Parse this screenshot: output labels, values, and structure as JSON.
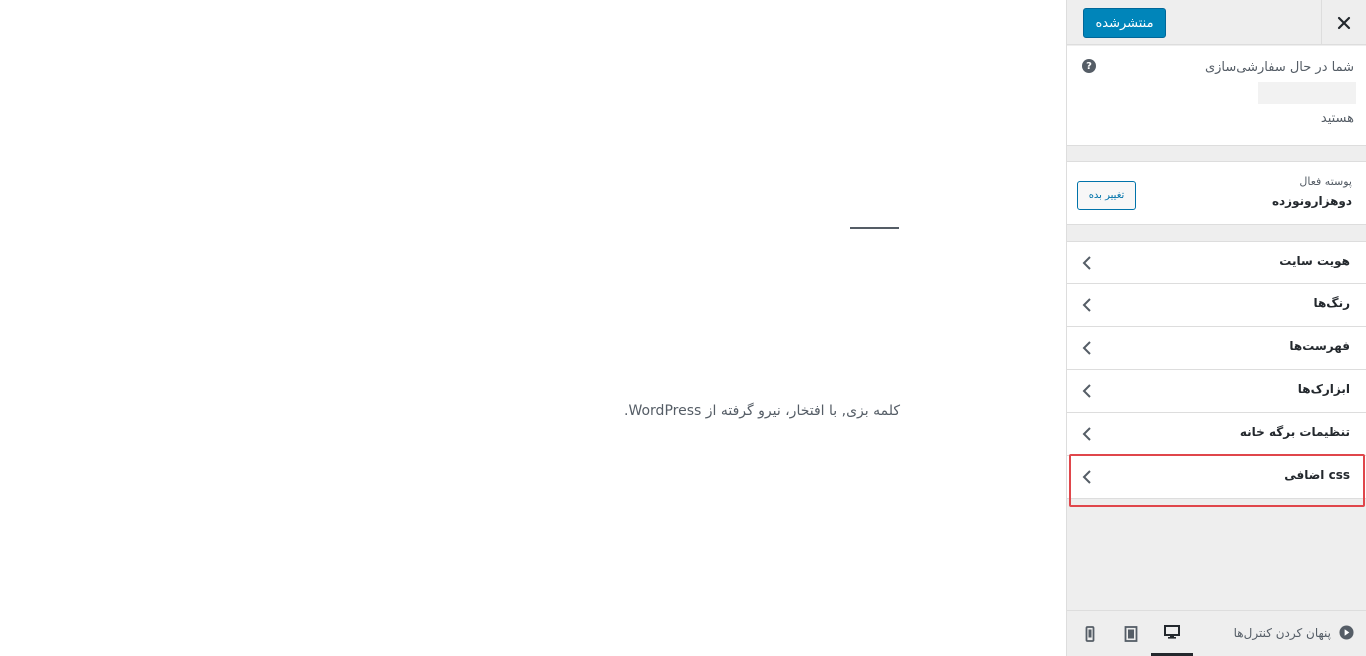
{
  "header": {
    "publish_label": "منتشرشده",
    "close_icon": "close-icon"
  },
  "info": {
    "line1": "شما در حال سفارشی‌سازی",
    "line3": "هستید",
    "help_symbol": "?"
  },
  "theme": {
    "label": "پوسته فعال",
    "name": "دوهزارونوزده",
    "change_label": "تغییر بده"
  },
  "menu": {
    "items": [
      {
        "label": "هویت سایت"
      },
      {
        "label": "رنگ‌ها"
      },
      {
        "label": "فهرست‌ها"
      },
      {
        "label": "ابزارک‌ها"
      },
      {
        "label": "تنظیمات برگه خانه"
      },
      {
        "label": "css اضافی"
      }
    ]
  },
  "footer": {
    "hide_controls_label": "پنهان کردن کنترل‌ها",
    "devices": [
      "desktop",
      "tablet",
      "mobile"
    ],
    "active_device": "desktop"
  },
  "preview": {
    "credit": "کلمه بزی, با افتخار، نیرو گرفته از WordPress."
  },
  "colors": {
    "accent": "#0085ba",
    "highlight": "#e0464b",
    "sidebar_bg": "#eeeeee"
  }
}
